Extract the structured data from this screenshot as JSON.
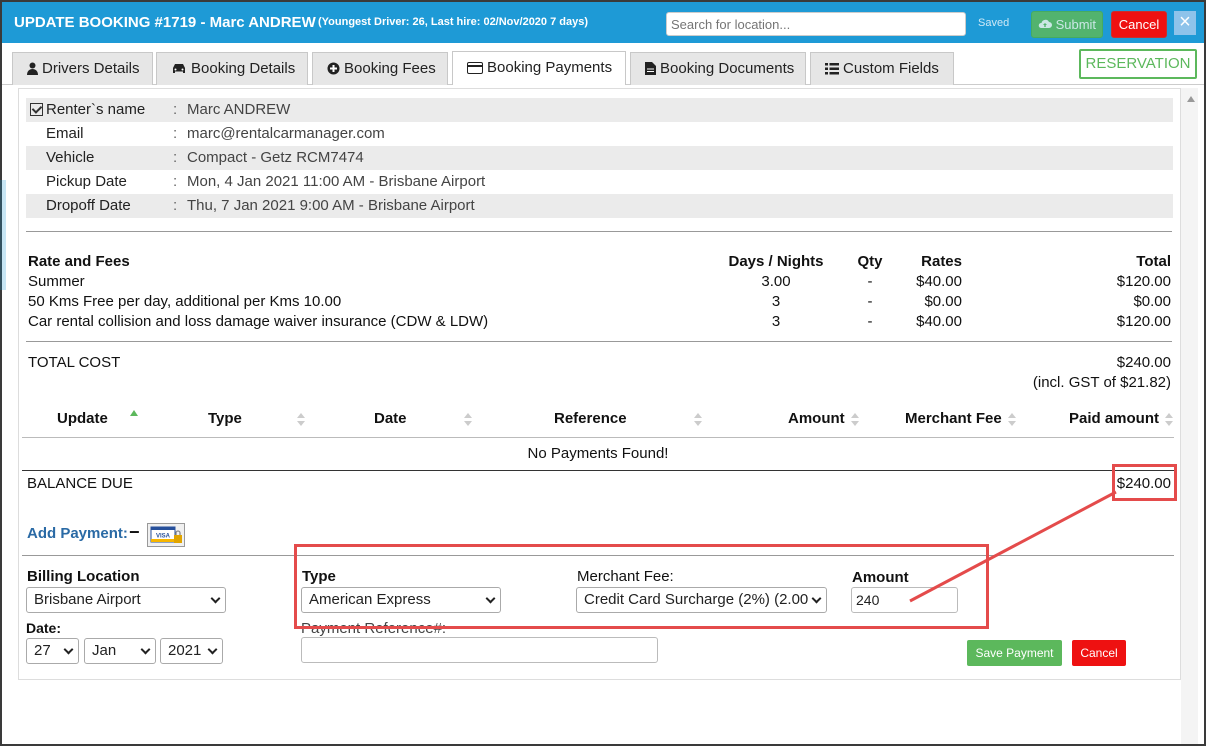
{
  "header": {
    "title": "UPDATE BOOKING #1719  - Marc ANDREW",
    "subtitle": "(Youngest Driver: 26, Last hire: 02/Nov/2020 7 days)",
    "search_placeholder": "Search for location...",
    "saved_label": "Saved",
    "submit_label": "Submit",
    "cancel_label": "Cancel",
    "close_label": "×"
  },
  "tabs": [
    {
      "label": "Drivers Details",
      "icon": "user-icon"
    },
    {
      "label": "Booking Details",
      "icon": "car-icon"
    },
    {
      "label": "Booking Fees",
      "icon": "plus-circle-icon"
    },
    {
      "label": "Booking Payments",
      "icon": "credit-card-icon",
      "active": true
    },
    {
      "label": "Booking Documents",
      "icon": "document-icon"
    },
    {
      "label": "Custom Fields",
      "icon": "list-icon"
    }
  ],
  "status_badge": "RESERVATION",
  "booking_info": {
    "renter_label": "Renter`s name",
    "renter_value": "Marc ANDREW",
    "email_label": "Email",
    "email_value": "marc@rentalcarmanager.com",
    "vehicle_label": "Vehicle",
    "vehicle_value": "Compact - Getz RCM7474",
    "pickup_label": "Pickup Date",
    "pickup_value": "Mon, 4 Jan 2021 11:00 AM - Brisbane Airport",
    "dropoff_label": "Dropoff Date",
    "dropoff_value": "Thu, 7 Jan 2021 9:00 AM - Brisbane Airport",
    "colon": ":"
  },
  "fees": {
    "headers": {
      "name": "Rate and Fees",
      "days": "Days / Nights",
      "qty": "Qty",
      "rates": "Rates",
      "total": "Total"
    },
    "rows": [
      {
        "name": "Summer",
        "days": "3.00",
        "qty": "-",
        "rates": "$40.00",
        "total": "$120.00"
      },
      {
        "name": "50 Kms Free per day, additional per Kms 10.00",
        "days": "3",
        "qty": "-",
        "rates": "$0.00",
        "total": "$0.00"
      },
      {
        "name": "Car rental collision and loss damage waiver insurance (CDW & LDW)",
        "days": "3",
        "qty": "-",
        "rates": "$40.00",
        "total": "$120.00"
      }
    ],
    "total_label": "TOTAL COST",
    "total_value": "$240.00",
    "gst_note": "(incl. GST of $21.82)"
  },
  "payments": {
    "headers": {
      "update": "Update",
      "type": "Type",
      "date": "Date",
      "reference": "Reference",
      "amount": "Amount",
      "merchant_fee": "Merchant Fee",
      "paid_amount": "Paid amount"
    },
    "empty_message": "No Payments Found!",
    "balance_label": "BALANCE DUE",
    "balance_value": "$240.00"
  },
  "add_payment": {
    "label": "Add Payment:",
    "toggle": "−",
    "card_label": "VISA",
    "billing_location_label": "Billing Location",
    "billing_location_value": "Brisbane Airport",
    "type_label": "Type",
    "type_value": "American Express",
    "merchant_fee_label": "Merchant Fee:",
    "merchant_fee_value": "Credit Card Surcharge (2%) (2.00",
    "amount_label": "Amount",
    "amount_value": "240",
    "date_label": "Date:",
    "date_day": "27",
    "date_month": "Jan",
    "date_year": "2021",
    "reference_label": "Payment Reference#:",
    "reference_value": "",
    "save_label": "Save Payment",
    "cancel_label": "Cancel"
  },
  "colors": {
    "header_blue": "#1e9ad6",
    "submit_green": "#5cb85c",
    "cancel_red": "#ee1111",
    "annotation_red": "#e44b4b",
    "link_blue": "#2a6aa5"
  }
}
